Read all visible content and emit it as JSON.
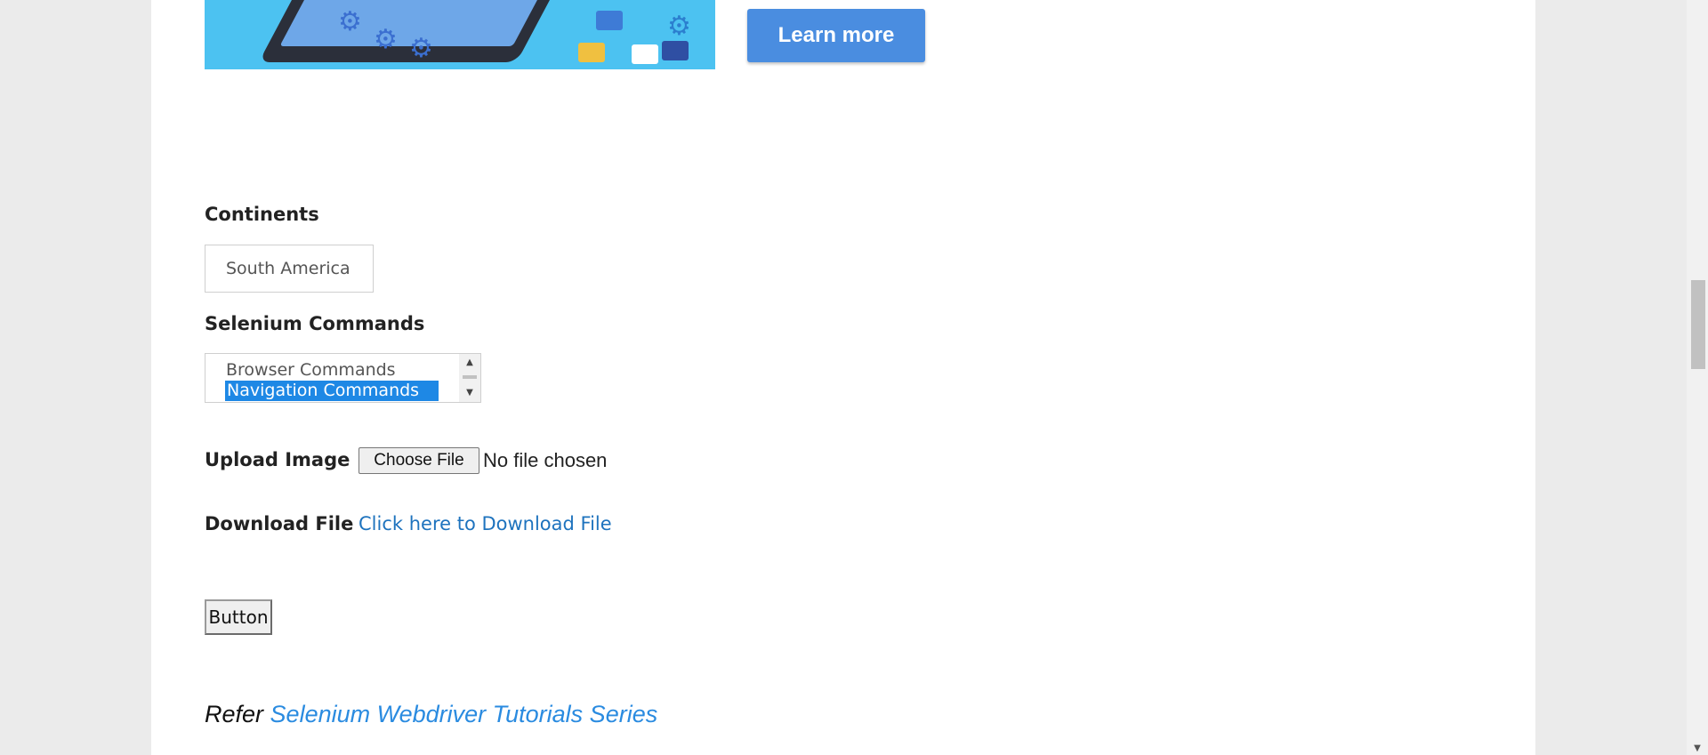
{
  "banner": {
    "learn_more_label": "Learn more"
  },
  "continents": {
    "label": "Continents",
    "selected": "South America"
  },
  "selenium_commands": {
    "label": "Selenium Commands",
    "options": [
      "Browser Commands",
      "Navigation Commands"
    ],
    "selected": "Navigation Commands"
  },
  "upload": {
    "label": "Upload Image",
    "button_label": "Choose File",
    "status": "No file chosen"
  },
  "download": {
    "label": "Download File",
    "link_text": "Click here to Download File"
  },
  "button": {
    "label": "Button"
  },
  "refer": {
    "prefix": "Refer",
    "link_text": "Selenium Webdriver Tutorials Series"
  },
  "colors": {
    "accent": "#4a8de0",
    "link": "#1e73be",
    "selection": "#1e88e5"
  },
  "icons": {
    "scroll_up": "triangle-up-icon",
    "scroll_down": "triangle-down-icon"
  }
}
